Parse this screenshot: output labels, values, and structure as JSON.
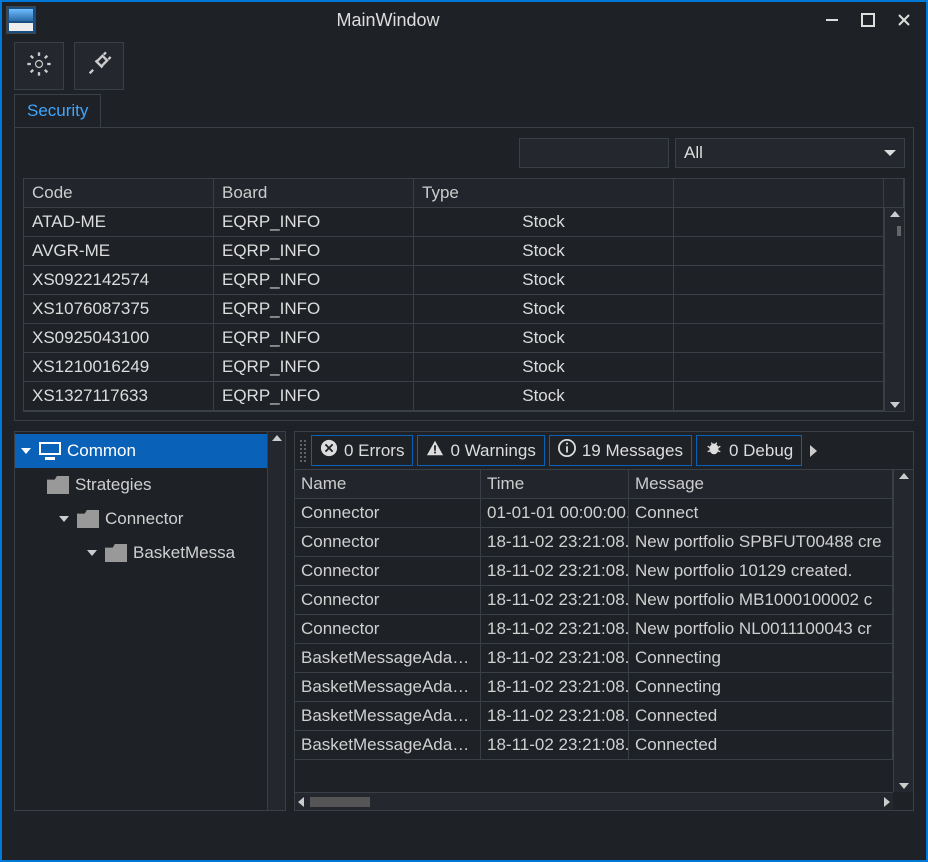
{
  "window": {
    "title": "MainWindow"
  },
  "tabs": {
    "security": "Security"
  },
  "filter": {
    "all_label": "All"
  },
  "securities": {
    "columns": {
      "code": "Code",
      "board": "Board",
      "type": "Type"
    },
    "rows": [
      {
        "code": "ATAD-ME",
        "board": "EQRP_INFO",
        "type": "Stock"
      },
      {
        "code": "AVGR-ME",
        "board": "EQRP_INFO",
        "type": "Stock"
      },
      {
        "code": "XS0922142574",
        "board": "EQRP_INFO",
        "type": "Stock"
      },
      {
        "code": "XS1076087375",
        "board": "EQRP_INFO",
        "type": "Stock"
      },
      {
        "code": "XS0925043100",
        "board": "EQRP_INFO",
        "type": "Stock"
      },
      {
        "code": "XS1210016249",
        "board": "EQRP_INFO",
        "type": "Stock"
      },
      {
        "code": "XS1327117633",
        "board": "EQRP_INFO",
        "type": "Stock"
      }
    ]
  },
  "tree": {
    "common": "Common",
    "strategies": "Strategies",
    "connector": "Connector",
    "basket": "BasketMessa"
  },
  "log_toolbar": {
    "errors": "0 Errors",
    "warnings": "0 Warnings",
    "messages": "19 Messages",
    "debug": "0 Debug"
  },
  "log": {
    "columns": {
      "name": "Name",
      "time": "Time",
      "message": "Message"
    },
    "rows": [
      {
        "name": "Connector",
        "time": "01-01-01 00:00:00.",
        "message": "Connect"
      },
      {
        "name": "Connector",
        "time": "18-11-02 23:21:08.",
        "message": "New portfolio SPBFUT00488 cre"
      },
      {
        "name": "Connector",
        "time": "18-11-02 23:21:08.",
        "message": "New portfolio 10129 created."
      },
      {
        "name": "Connector",
        "time": "18-11-02 23:21:08.",
        "message": "New portfolio MB1000100002 c"
      },
      {
        "name": "Connector",
        "time": "18-11-02 23:21:08.",
        "message": "New portfolio NL0011100043 cr"
      },
      {
        "name": "BasketMessageAda…",
        "time": "18-11-02 23:21:08.",
        "message": "Connecting"
      },
      {
        "name": "BasketMessageAda…",
        "time": "18-11-02 23:21:08.",
        "message": "Connecting"
      },
      {
        "name": "BasketMessageAda…",
        "time": "18-11-02 23:21:08.",
        "message": "Connected"
      },
      {
        "name": "BasketMessageAda…",
        "time": "18-11-02 23:21:08.",
        "message": "Connected"
      }
    ]
  }
}
